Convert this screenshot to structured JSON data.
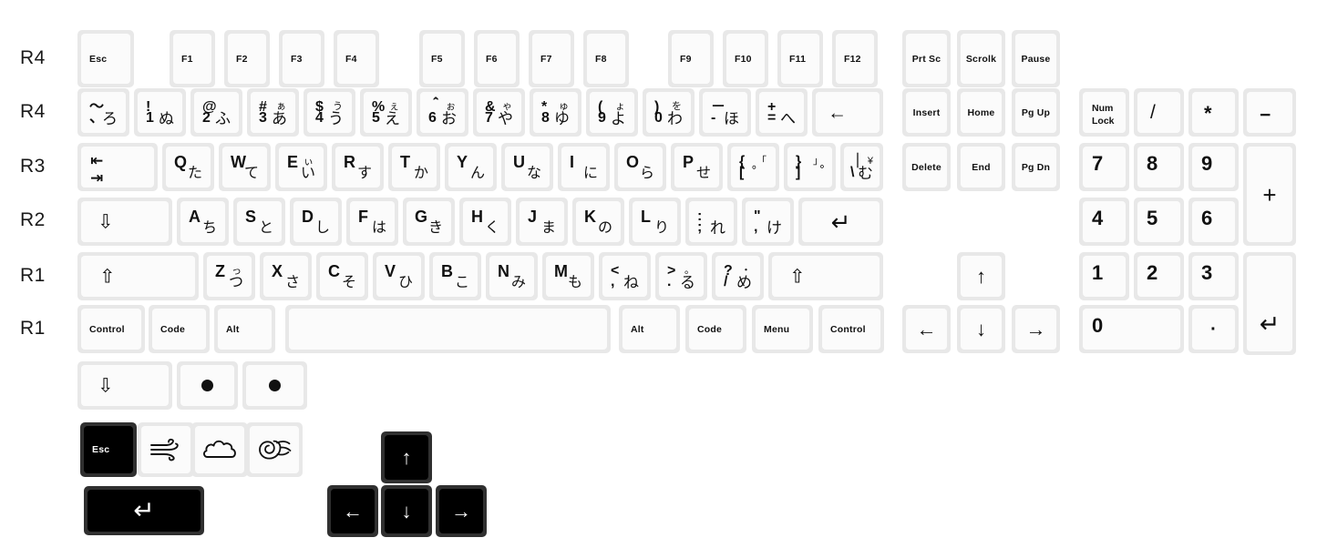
{
  "meta": {
    "title": "JIS Japanese keycap set layout",
    "background": "#ffffff",
    "key_socket_color": "#e8e8e8",
    "key_cap_color": "#fbfbfb",
    "dark_socket_color": "#303030",
    "dark_cap_color": "#000000",
    "legend_color": "#111111",
    "dark_legend_color": "#ffffff"
  },
  "profile_labels": [
    {
      "text": "R4",
      "row": "function-row"
    },
    {
      "text": "R4",
      "row": "number-row"
    },
    {
      "text": "R3",
      "row": "qwerty-row"
    },
    {
      "text": "R2",
      "row": "home-row"
    },
    {
      "text": "R1",
      "row": "bottom-letter-row"
    },
    {
      "text": "R1",
      "row": "modifier-row"
    }
  ],
  "function_row": [
    {
      "label": "Esc"
    },
    {
      "label": "F1"
    },
    {
      "label": "F2"
    },
    {
      "label": "F3"
    },
    {
      "label": "F4"
    },
    {
      "label": "F5"
    },
    {
      "label": "F6"
    },
    {
      "label": "F7"
    },
    {
      "label": "F8"
    },
    {
      "label": "F9"
    },
    {
      "label": "F10"
    },
    {
      "label": "F11"
    },
    {
      "label": "F12"
    }
  ],
  "number_row": [
    {
      "tl": "～",
      "tr": "",
      "bl": "、",
      "br": "ろ"
    },
    {
      "tl": "!",
      "tr": "",
      "bl": "1",
      "br": "ぬ"
    },
    {
      "tl": "@",
      "tr": "",
      "bl": "2",
      "br": "ふ"
    },
    {
      "tl": "#",
      "tr": "ぁ",
      "bl": "3",
      "br": "あ"
    },
    {
      "tl": "$",
      "tr": "う",
      "bl": "4",
      "br": "う"
    },
    {
      "tl": "%",
      "tr": "ぇ",
      "bl": "5",
      "br": "え"
    },
    {
      "tl": "＾",
      "tr": "ぉ",
      "bl": "6",
      "br": "お"
    },
    {
      "tl": "&",
      "tr": "ゃ",
      "bl": "7",
      "br": "や"
    },
    {
      "tl": "*",
      "tr": "ゅ",
      "bl": "8",
      "br": "ゆ"
    },
    {
      "tl": "(",
      "tr": "ょ",
      "bl": "9",
      "br": "よ"
    },
    {
      "tl": ")",
      "tr": "を",
      "bl": "0",
      "br": "わ"
    },
    {
      "tl": "－",
      "tr": "",
      "bl": "-",
      "br": "ほ"
    },
    {
      "tl": "+",
      "tr": "",
      "bl": "=",
      "br": "へ"
    }
  ],
  "number_row_backspace": {
    "glyph": "←",
    "name": "backspace"
  },
  "qwerty_row": {
    "tab": {
      "top": "⇤",
      "bottom": "⇥",
      "name": "tab"
    },
    "keys": [
      {
        "letter": "Q",
        "kana": "た",
        "tr": ""
      },
      {
        "letter": "W",
        "kana": "て",
        "tr": ""
      },
      {
        "letter": "E",
        "kana": "い",
        "tr": "ぃ"
      },
      {
        "letter": "R",
        "kana": "す",
        "tr": ""
      },
      {
        "letter": "T",
        "kana": "か",
        "tr": ""
      },
      {
        "letter": "Y",
        "kana": "ん",
        "tr": ""
      },
      {
        "letter": "U",
        "kana": "な",
        "tr": ""
      },
      {
        "letter": "I",
        "kana": "に",
        "tr": ""
      },
      {
        "letter": "O",
        "kana": "ら",
        "tr": ""
      },
      {
        "letter": "P",
        "kana": "せ",
        "tr": ""
      }
    ],
    "bracket_left": {
      "tl": "{",
      "tr": "「",
      "bl": "[",
      "br": "゜"
    },
    "bracket_right": {
      "tl": "}",
      "tr": "」",
      "bl": "]",
      "br": "゚"
    },
    "yen": {
      "tl": "｜",
      "tr": "¥",
      "bl": "\\",
      "br": "む"
    }
  },
  "home_row": {
    "capslock": {
      "glyph": "⇩",
      "name": "caps-lock"
    },
    "keys": [
      {
        "letter": "A",
        "kana": "ち"
      },
      {
        "letter": "S",
        "kana": "と"
      },
      {
        "letter": "D",
        "kana": "し"
      },
      {
        "letter": "F",
        "kana": "は"
      },
      {
        "letter": "G",
        "kana": "き"
      },
      {
        "letter": "H",
        "kana": "く"
      },
      {
        "letter": "J",
        "kana": "ま"
      },
      {
        "letter": "K",
        "kana": "の"
      },
      {
        "letter": "L",
        "kana": "り"
      }
    ],
    "colon": {
      "tl": ":",
      "tr": "",
      "bl": ";",
      "br": "れ"
    },
    "quote": {
      "tl": "\"",
      "tr": "",
      "bl": ",",
      "br": "け"
    },
    "enter": {
      "glyph": "↵",
      "name": "enter"
    }
  },
  "bottom_letter_row": {
    "shift_left": {
      "glyph": "⇧",
      "name": "left-shift"
    },
    "shift_right": {
      "glyph": "⇧",
      "name": "right-shift"
    },
    "keys": [
      {
        "letter": "Z",
        "kana": "つ",
        "tr": "っ"
      },
      {
        "letter": "X",
        "kana": "さ",
        "tr": ""
      },
      {
        "letter": "C",
        "kana": "そ",
        "tr": ""
      },
      {
        "letter": "V",
        "kana": "ひ",
        "tr": ""
      },
      {
        "letter": "B",
        "kana": "こ",
        "tr": ""
      },
      {
        "letter": "N",
        "kana": "み",
        "tr": ""
      },
      {
        "letter": "M",
        "kana": "も",
        "tr": ""
      }
    ],
    "comma": {
      "tl": "<",
      "tr": "",
      "bl": ",",
      "br": "ね"
    },
    "period": {
      "tl": ">",
      "tr": "。",
      "bl": ".",
      "br": "る"
    },
    "slash": {
      "tl": "?",
      "tr": "・",
      "bl": "/",
      "br": "め"
    }
  },
  "modifier_row": [
    {
      "label": "Control",
      "name": "left-control"
    },
    {
      "label": "Code",
      "name": "left-code"
    },
    {
      "label": "Alt",
      "name": "left-alt"
    },
    {
      "label": "",
      "name": "spacebar"
    },
    {
      "label": "Alt",
      "name": "right-alt"
    },
    {
      "label": "Code",
      "name": "right-code"
    },
    {
      "label": "Menu",
      "name": "menu"
    },
    {
      "label": "Control",
      "name": "right-control"
    }
  ],
  "extras_row": {
    "wide_arrow": {
      "glyph": "⇩",
      "name": "caps-lock-alt"
    },
    "dots": [
      {
        "name": "indicator-blank-1"
      },
      {
        "name": "indicator-blank-2"
      }
    ]
  },
  "nav_cluster": [
    {
      "label": "Prt Sc"
    },
    {
      "label": "Scrolk"
    },
    {
      "label": "Pause"
    },
    {
      "label": "Insert"
    },
    {
      "label": "Home"
    },
    {
      "label": "Pg Up"
    },
    {
      "label": "Delete"
    },
    {
      "label": "End"
    },
    {
      "label": "Pg Dn"
    }
  ],
  "arrow_cluster": [
    {
      "glyph": "↑",
      "name": "arrow-up"
    },
    {
      "glyph": "←",
      "name": "arrow-left"
    },
    {
      "glyph": "↓",
      "name": "arrow-down"
    },
    {
      "glyph": "→",
      "name": "arrow-right"
    }
  ],
  "numpad": {
    "numlock": {
      "line1": "Num",
      "line2": "Lock"
    },
    "divide": "/",
    "multiply": "*",
    "minus": "−",
    "plus": "+",
    "enter": "↵",
    "digits": [
      "7",
      "8",
      "9",
      "4",
      "5",
      "6",
      "1",
      "2",
      "3",
      "0"
    ],
    "decimal": "·"
  },
  "novelty": {
    "esc": {
      "label": "Esc",
      "name": "novelty-esc"
    },
    "icons": [
      {
        "name": "wind-icon"
      },
      {
        "name": "cloud-icon"
      },
      {
        "name": "typhoon-swirl-icon"
      }
    ],
    "enter": {
      "glyph": "↵",
      "name": "novelty-enter"
    },
    "arrows": [
      {
        "glyph": "↑",
        "name": "novelty-arrow-up"
      },
      {
        "glyph": "←",
        "name": "novelty-arrow-left"
      },
      {
        "glyph": "↓",
        "name": "novelty-arrow-down"
      },
      {
        "glyph": "→",
        "name": "novelty-arrow-right"
      }
    ]
  }
}
